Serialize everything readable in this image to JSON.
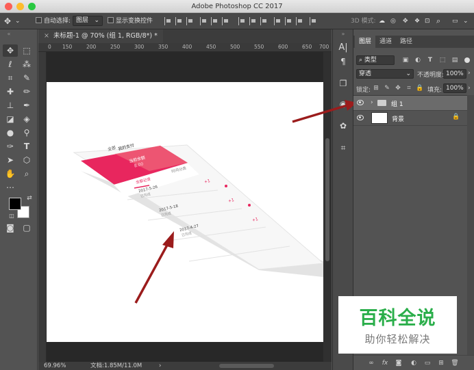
{
  "window": {
    "title": "Adobe Photoshop CC 2017"
  },
  "options_bar": {
    "auto_select_label": "自动选择:",
    "auto_select_value": "图层",
    "show_transform_label": "显示变换控件",
    "mode_3d_label": "3D 模式:"
  },
  "document": {
    "tab_title": "未标题-1 @ 70% (组 1, RGB/8*) *",
    "ruler_ticks": [
      "0",
      "150",
      "200",
      "250",
      "300",
      "350",
      "400",
      "450",
      "500",
      "550",
      "600",
      "650",
      "700"
    ],
    "zoom": "69.96%",
    "doc_size": "文档:1.85M/11.0M"
  },
  "canvas_mockup": {
    "header_left": "全部",
    "header_mid": "我的支付",
    "banner_title": "当前余额",
    "banner_value": "8.00",
    "tab_1": "全部记录",
    "tab_2": "时间分类",
    "rows": [
      {
        "date": "2017-5-26",
        "desc": "已完成",
        "amount": "+1"
      },
      {
        "date": "2017-5-18",
        "desc": "已完成",
        "amount": "+1"
      },
      {
        "date": "2017-4-27",
        "desc": "已完成",
        "amount": "+1"
      }
    ],
    "arrow_color": "#9b1c1c",
    "accent_color": "#e8265e"
  },
  "layers_panel": {
    "tabs": [
      "图层",
      "通道",
      "路径"
    ],
    "kind_filter": "类型",
    "blend_mode": "穿透",
    "opacity_label": "不透明度:",
    "opacity_value": "100%",
    "lock_label": "锁定:",
    "fill_label": "填充:",
    "fill_value": "100%",
    "layers": [
      {
        "name": "组 1",
        "type": "group",
        "selected": true
      },
      {
        "name": "背景",
        "type": "background",
        "locked": true
      }
    ]
  },
  "watermark": {
    "line1": "百科全说",
    "line2": "助你轻松解决",
    "color": "#2aae4a"
  }
}
